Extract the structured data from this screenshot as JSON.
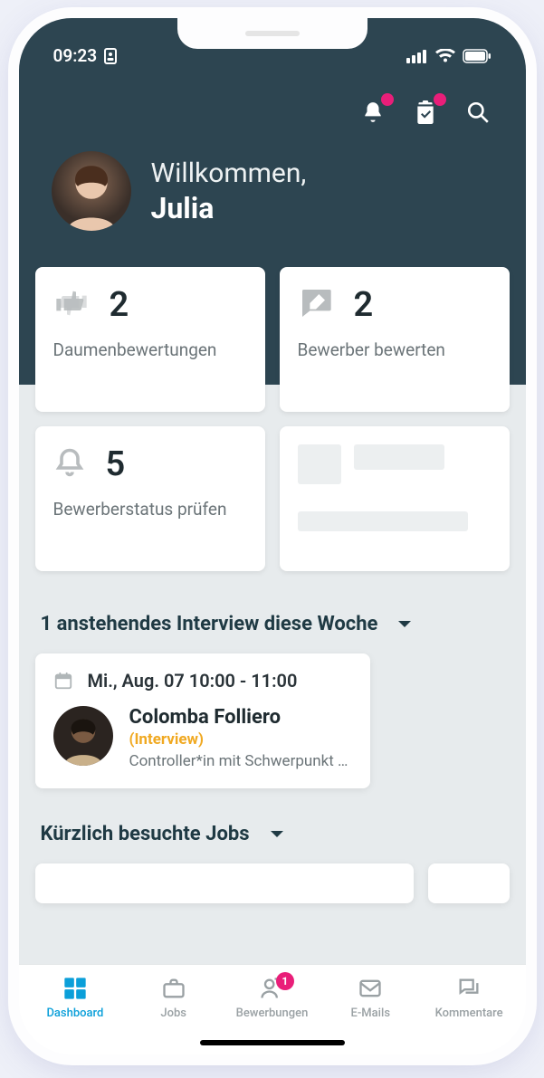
{
  "status": {
    "time": "09:23"
  },
  "greeting": {
    "hello": "Willkommen,",
    "name": "Julia"
  },
  "cards": {
    "thumbs": {
      "count": "2",
      "label": "Daumenbewertungen"
    },
    "rate": {
      "count": "2",
      "label": "Bewerber bewerten"
    },
    "status": {
      "count": "5",
      "label": "Bewerberstatus prüfen"
    }
  },
  "interviews": {
    "heading": "1 anstehendes Interview diese Woche",
    "item": {
      "date": "Mi., Aug. 07 10:00 - 11:00",
      "name": "Colomba Folliero",
      "type": "(Interview)",
      "role": "Controller*in mit Schwerpunkt L..."
    }
  },
  "recent": {
    "heading": "Kürzlich besuchte Jobs"
  },
  "tabs": {
    "dashboard": "Dashboard",
    "jobs": "Jobs",
    "apps": "Bewerbungen",
    "apps_badge": "1",
    "emails": "E-Mails",
    "comments": "Kommentare"
  }
}
